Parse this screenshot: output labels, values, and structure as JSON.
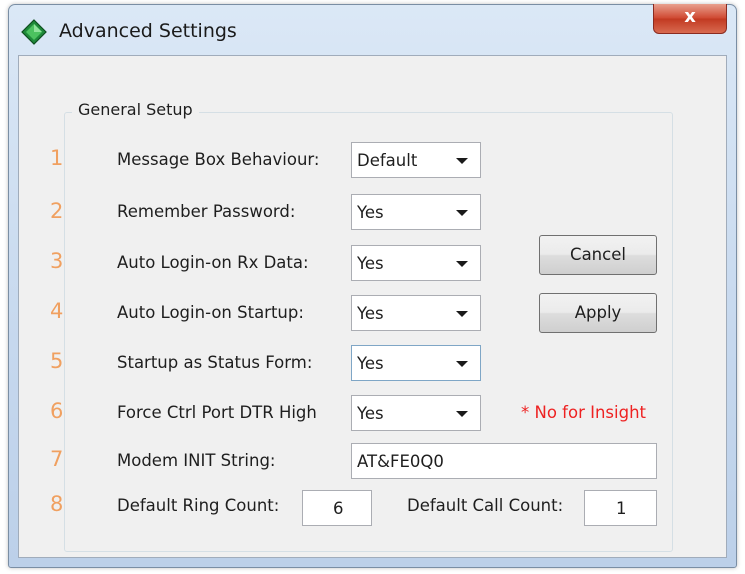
{
  "window": {
    "title": "Advanced Settings",
    "close_label": "x"
  },
  "group": {
    "title": "General Setup"
  },
  "rows": [
    {
      "num": "1",
      "label": "Message Box Behaviour:",
      "value": "Default"
    },
    {
      "num": "2",
      "label": "Remember Password:",
      "value": "Yes"
    },
    {
      "num": "3",
      "label": "Auto Login-on Rx Data:",
      "value": "Yes"
    },
    {
      "num": "4",
      "label": "Auto Login-on Startup:",
      "value": "Yes"
    },
    {
      "num": "5",
      "label": "Startup as Status Form:",
      "value": "Yes"
    },
    {
      "num": "6",
      "label": "Force Ctrl Port DTR High",
      "value": "Yes"
    },
    {
      "num": "7",
      "label": "Modem INIT String:",
      "value": "AT&FE0Q0"
    },
    {
      "num": "8",
      "label": "Default Ring Count:",
      "value": "6"
    }
  ],
  "call_count": {
    "label": "Default Call Count:",
    "value": "1"
  },
  "note": "* No for Insight",
  "buttons": {
    "cancel": "Cancel",
    "apply": "Apply"
  },
  "colors": {
    "row_number": "#f0a060",
    "note": "#ee2222",
    "close_button": "#c94a32"
  },
  "icons": {
    "app": "green-diamond-icon"
  }
}
